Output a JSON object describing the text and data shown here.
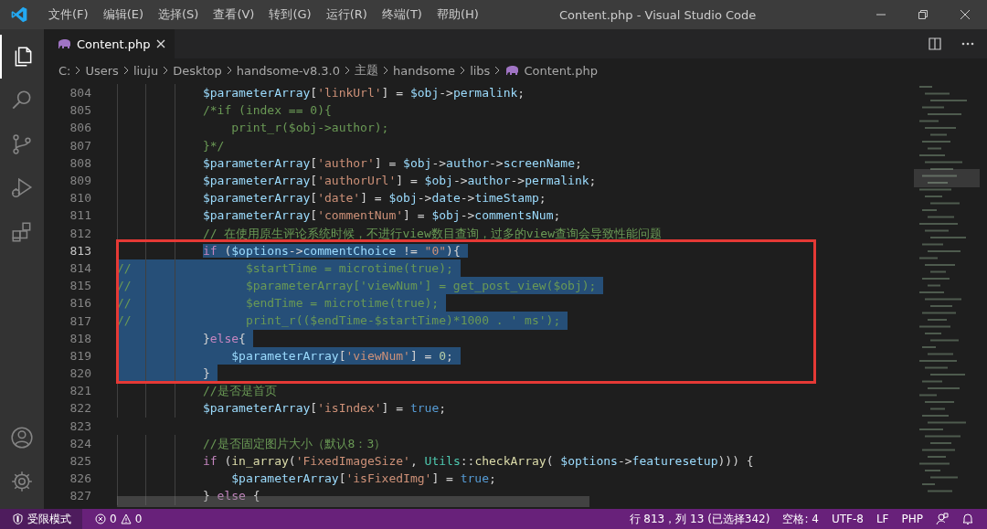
{
  "window": {
    "title": "Content.php - Visual Studio Code"
  },
  "menu": [
    "文件(F)",
    "编辑(E)",
    "选择(S)",
    "查看(V)",
    "转到(G)",
    "运行(R)",
    "终端(T)",
    "帮助(H)"
  ],
  "activity_bar": [
    {
      "kind": "files",
      "selected": true
    },
    {
      "kind": "search",
      "selected": false
    },
    {
      "kind": "source-control",
      "selected": false
    },
    {
      "kind": "run",
      "selected": false
    },
    {
      "kind": "extensions",
      "selected": false
    }
  ],
  "tabs": [
    {
      "label": "Content.php",
      "selected": true
    }
  ],
  "breadcrumbs": [
    "C:",
    "Users",
    "liuju",
    "Desktop",
    "handsome-v8.3.0",
    "主题",
    "handsome",
    "libs",
    "Content.php"
  ],
  "code": {
    "lines": [
      {
        "number": "804",
        "selected": false,
        "cursor": false,
        "kind": "block",
        "tokens": [
          {
            "text": "$parameterArray",
            "kind": "var"
          },
          {
            "text": "[",
            "kind": "plain"
          },
          {
            "text": "'linkUrl'",
            "kind": "str"
          },
          {
            "text": "] = ",
            "kind": "plain"
          },
          {
            "text": "$obj",
            "kind": "var"
          },
          {
            "text": "->",
            "kind": "plain"
          },
          {
            "text": "permalink",
            "kind": "var"
          },
          {
            "text": ";",
            "kind": "plain"
          }
        ]
      },
      {
        "number": "805",
        "selected": false,
        "cursor": false,
        "kind": "block",
        "tokens": [
          {
            "text": "/*if (index == 0){",
            "kind": "comment"
          }
        ]
      },
      {
        "number": "806",
        "selected": false,
        "cursor": false,
        "kind": "nested",
        "tokens": [
          {
            "text": "print_r($obj->author);",
            "kind": "comment"
          }
        ]
      },
      {
        "number": "807",
        "selected": false,
        "cursor": false,
        "kind": "block",
        "tokens": [
          {
            "text": "}*/",
            "kind": "comment"
          }
        ]
      },
      {
        "number": "808",
        "selected": false,
        "cursor": false,
        "kind": "block",
        "tokens": [
          {
            "text": "$parameterArray",
            "kind": "var"
          },
          {
            "text": "[",
            "kind": "plain"
          },
          {
            "text": "'author'",
            "kind": "str"
          },
          {
            "text": "] = ",
            "kind": "plain"
          },
          {
            "text": "$obj",
            "kind": "var"
          },
          {
            "text": "->",
            "kind": "plain"
          },
          {
            "text": "author",
            "kind": "var"
          },
          {
            "text": "->",
            "kind": "plain"
          },
          {
            "text": "screenName",
            "kind": "var"
          },
          {
            "text": ";",
            "kind": "plain"
          }
        ]
      },
      {
        "number": "809",
        "selected": false,
        "cursor": false,
        "kind": "block",
        "tokens": [
          {
            "text": "$parameterArray",
            "kind": "var"
          },
          {
            "text": "[",
            "kind": "plain"
          },
          {
            "text": "'authorUrl'",
            "kind": "str"
          },
          {
            "text": "] = ",
            "kind": "plain"
          },
          {
            "text": "$obj",
            "kind": "var"
          },
          {
            "text": "->",
            "kind": "plain"
          },
          {
            "text": "author",
            "kind": "var"
          },
          {
            "text": "->",
            "kind": "plain"
          },
          {
            "text": "permalink",
            "kind": "var"
          },
          {
            "text": ";",
            "kind": "plain"
          }
        ]
      },
      {
        "number": "810",
        "selected": false,
        "cursor": false,
        "kind": "block",
        "tokens": [
          {
            "text": "$parameterArray",
            "kind": "var"
          },
          {
            "text": "[",
            "kind": "plain"
          },
          {
            "text": "'date'",
            "kind": "str"
          },
          {
            "text": "] = ",
            "kind": "plain"
          },
          {
            "text": "$obj",
            "kind": "var"
          },
          {
            "text": "->",
            "kind": "plain"
          },
          {
            "text": "date",
            "kind": "var"
          },
          {
            "text": "->",
            "kind": "plain"
          },
          {
            "text": "timeStamp",
            "kind": "var"
          },
          {
            "text": ";",
            "kind": "plain"
          }
        ]
      },
      {
        "number": "811",
        "selected": false,
        "cursor": false,
        "kind": "block",
        "tokens": [
          {
            "text": "$parameterArray",
            "kind": "var"
          },
          {
            "text": "[",
            "kind": "plain"
          },
          {
            "text": "'commentNum'",
            "kind": "str"
          },
          {
            "text": "] = ",
            "kind": "plain"
          },
          {
            "text": "$obj",
            "kind": "var"
          },
          {
            "text": "->",
            "kind": "plain"
          },
          {
            "text": "commentsNum",
            "kind": "var"
          },
          {
            "text": ";",
            "kind": "plain"
          }
        ]
      },
      {
        "number": "812",
        "selected": false,
        "cursor": false,
        "kind": "block",
        "tokens": [
          {
            "text": "// 在使用原生评论系统时候，不进行view数目查询，过多的view查询会导致性能问题",
            "kind": "comment"
          }
        ]
      },
      {
        "number": "813",
        "selected": true,
        "cursor": true,
        "kind": "block",
        "tokens": [
          {
            "text": "if",
            "kind": "keyword"
          },
          {
            "text": " (",
            "kind": "plain"
          },
          {
            "text": "$options",
            "kind": "var"
          },
          {
            "text": "->",
            "kind": "plain"
          },
          {
            "text": "commentChoice",
            "kind": "var"
          },
          {
            "text": " != ",
            "kind": "plain"
          },
          {
            "text": "\"0\"",
            "kind": "str"
          },
          {
            "text": "){",
            "kind": "plain"
          }
        ]
      },
      {
        "number": "814",
        "selected": true,
        "cursor": false,
        "kind": "flush",
        "tokens": [
          {
            "text": "//                $startTime = microtime(true);",
            "kind": "comment"
          }
        ]
      },
      {
        "number": "815",
        "selected": true,
        "cursor": false,
        "kind": "flush",
        "tokens": [
          {
            "text": "//                $parameterArray['viewNum'] = get_post_view($obj);",
            "kind": "comment"
          }
        ]
      },
      {
        "number": "816",
        "selected": true,
        "cursor": false,
        "kind": "flush",
        "tokens": [
          {
            "text": "//                $endTime = microtime(true);",
            "kind": "comment"
          }
        ]
      },
      {
        "number": "817",
        "selected": true,
        "cursor": false,
        "kind": "flush",
        "tokens": [
          {
            "text": "//                print_r(($endTime-$startTime)*1000 . ' ms');",
            "kind": "comment"
          }
        ]
      },
      {
        "number": "818",
        "selected": true,
        "cursor": false,
        "kind": "block",
        "tokens": [
          {
            "text": "}",
            "kind": "plain"
          },
          {
            "text": "else",
            "kind": "keyword"
          },
          {
            "text": "{",
            "kind": "plain"
          }
        ]
      },
      {
        "number": "819",
        "selected": true,
        "cursor": false,
        "kind": "nested",
        "tokens": [
          {
            "text": "$parameterArray",
            "kind": "var"
          },
          {
            "text": "[",
            "kind": "plain"
          },
          {
            "text": "'viewNum'",
            "kind": "str"
          },
          {
            "text": "] = ",
            "kind": "plain"
          },
          {
            "text": "0",
            "kind": "num"
          },
          {
            "text": ";",
            "kind": "plain"
          }
        ]
      },
      {
        "number": "820",
        "selected": true,
        "cursor": false,
        "kind": "block",
        "tokens": [
          {
            "text": "}",
            "kind": "plain"
          }
        ]
      },
      {
        "number": "821",
        "selected": false,
        "cursor": false,
        "kind": "block",
        "tokens": [
          {
            "text": "//是否是首页",
            "kind": "comment"
          }
        ]
      },
      {
        "number": "822",
        "selected": false,
        "cursor": false,
        "kind": "block",
        "tokens": [
          {
            "text": "$parameterArray",
            "kind": "var"
          },
          {
            "text": "[",
            "kind": "plain"
          },
          {
            "text": "'isIndex'",
            "kind": "str"
          },
          {
            "text": "] = ",
            "kind": "plain"
          },
          {
            "text": "true",
            "kind": "const"
          },
          {
            "text": ";",
            "kind": "plain"
          }
        ]
      },
      {
        "number": "823",
        "selected": false,
        "cursor": false
      },
      {
        "number": "824",
        "selected": false,
        "cursor": false,
        "kind": "block",
        "tokens": [
          {
            "text": "//是否固定图片大小（默认8：3）",
            "kind": "comment"
          }
        ]
      },
      {
        "number": "825",
        "selected": false,
        "cursor": false,
        "kind": "block",
        "tokens": [
          {
            "text": "if",
            "kind": "keyword"
          },
          {
            "text": " (",
            "kind": "plain"
          },
          {
            "text": "in_array",
            "kind": "func"
          },
          {
            "text": "(",
            "kind": "plain"
          },
          {
            "text": "'FixedImageSize'",
            "kind": "str"
          },
          {
            "text": ", ",
            "kind": "plain"
          },
          {
            "text": "Utils",
            "kind": "class"
          },
          {
            "text": "::",
            "kind": "plain"
          },
          {
            "text": "checkArray",
            "kind": "func"
          },
          {
            "text": "( ",
            "kind": "plain"
          },
          {
            "text": "$options",
            "kind": "var"
          },
          {
            "text": "->",
            "kind": "plain"
          },
          {
            "text": "featuresetup",
            "kind": "var"
          },
          {
            "text": "))) {",
            "kind": "plain"
          }
        ]
      },
      {
        "number": "826",
        "selected": false,
        "cursor": false,
        "kind": "nested",
        "tokens": [
          {
            "text": "$parameterArray",
            "kind": "var"
          },
          {
            "text": "[",
            "kind": "plain"
          },
          {
            "text": "'isFixedImg'",
            "kind": "str"
          },
          {
            "text": "] = ",
            "kind": "plain"
          },
          {
            "text": "true",
            "kind": "const"
          },
          {
            "text": ";",
            "kind": "plain"
          }
        ]
      },
      {
        "number": "827",
        "selected": false,
        "cursor": false,
        "kind": "block",
        "tokens": [
          {
            "text": "} ",
            "kind": "plain"
          },
          {
            "text": "else",
            "kind": "keyword"
          },
          {
            "text": " {",
            "kind": "plain"
          }
        ]
      }
    ]
  },
  "status_bar": {
    "mode": "受限模式",
    "errors": "0",
    "warnings": "0",
    "right": [
      "行 813，列 13 (已选择342)",
      "空格: 4",
      "UTF-8",
      "LF",
      "PHP"
    ]
  }
}
